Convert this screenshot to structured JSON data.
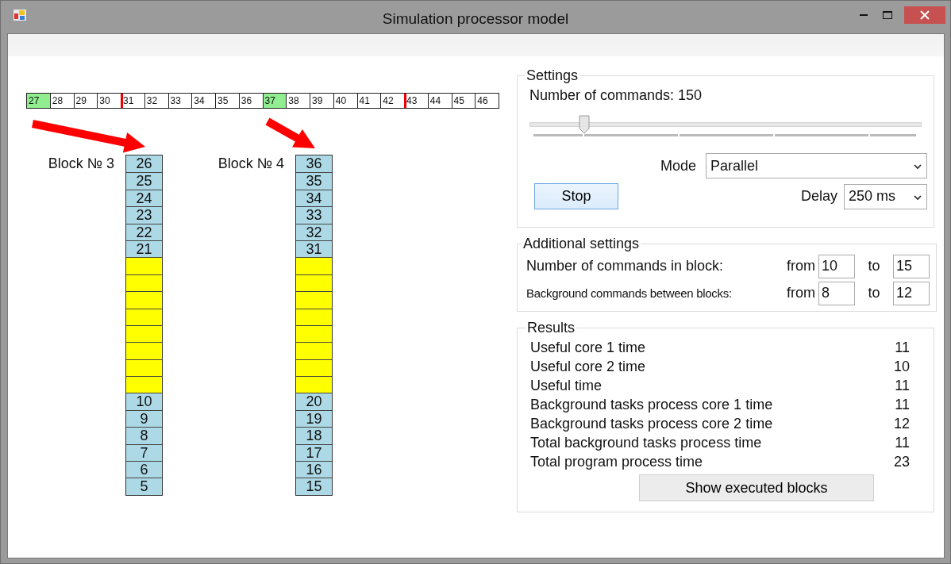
{
  "window": {
    "title": "Simulation processor model"
  },
  "command_strip": [
    {
      "text": "27",
      "highlighted": true,
      "boundary": false
    },
    {
      "text": "28",
      "highlighted": false,
      "boundary": false
    },
    {
      "text": "29",
      "highlighted": false,
      "boundary": false
    },
    {
      "text": "30",
      "highlighted": false,
      "boundary": false
    },
    {
      "text": "31",
      "highlighted": false,
      "boundary": true
    },
    {
      "text": "32",
      "highlighted": false,
      "boundary": false
    },
    {
      "text": "33",
      "highlighted": false,
      "boundary": false
    },
    {
      "text": "34",
      "highlighted": false,
      "boundary": false
    },
    {
      "text": "35",
      "highlighted": false,
      "boundary": false
    },
    {
      "text": "36",
      "highlighted": false,
      "boundary": false
    },
    {
      "text": "37",
      "highlighted": true,
      "boundary": false
    },
    {
      "text": "38",
      "highlighted": false,
      "boundary": false
    },
    {
      "text": "39",
      "highlighted": false,
      "boundary": false
    },
    {
      "text": "40",
      "highlighted": false,
      "boundary": false
    },
    {
      "text": "41",
      "highlighted": false,
      "boundary": false
    },
    {
      "text": "42",
      "highlighted": false,
      "boundary": false
    },
    {
      "text": "43",
      "highlighted": false,
      "boundary": true
    },
    {
      "text": "44",
      "highlighted": false,
      "boundary": false
    },
    {
      "text": "45",
      "highlighted": false,
      "boundary": false
    },
    {
      "text": "46",
      "highlighted": false,
      "boundary": false
    }
  ],
  "blocks": [
    {
      "label": "Block № 3",
      "cells": [
        {
          "kind": "command",
          "text": "26"
        },
        {
          "kind": "command",
          "text": "25"
        },
        {
          "kind": "command",
          "text": "24"
        },
        {
          "kind": "command",
          "text": "23"
        },
        {
          "kind": "command",
          "text": "22"
        },
        {
          "kind": "command",
          "text": "21"
        },
        {
          "kind": "background"
        },
        {
          "kind": "background"
        },
        {
          "kind": "background"
        },
        {
          "kind": "background"
        },
        {
          "kind": "background"
        },
        {
          "kind": "background"
        },
        {
          "kind": "background"
        },
        {
          "kind": "background"
        },
        {
          "kind": "command",
          "text": "10"
        },
        {
          "kind": "command",
          "text": "9"
        },
        {
          "kind": "command",
          "text": "8"
        },
        {
          "kind": "command",
          "text": "7"
        },
        {
          "kind": "command",
          "text": "6"
        },
        {
          "kind": "command",
          "text": "5"
        }
      ]
    },
    {
      "label": "Block № 4",
      "cells": [
        {
          "kind": "command",
          "text": "36"
        },
        {
          "kind": "command",
          "text": "35"
        },
        {
          "kind": "command",
          "text": "34"
        },
        {
          "kind": "command",
          "text": "33"
        },
        {
          "kind": "command",
          "text": "32"
        },
        {
          "kind": "command",
          "text": "31"
        },
        {
          "kind": "background"
        },
        {
          "kind": "background"
        },
        {
          "kind": "background"
        },
        {
          "kind": "background"
        },
        {
          "kind": "background"
        },
        {
          "kind": "background"
        },
        {
          "kind": "background"
        },
        {
          "kind": "background"
        },
        {
          "kind": "command",
          "text": "20"
        },
        {
          "kind": "command",
          "text": "19"
        },
        {
          "kind": "command",
          "text": "18"
        },
        {
          "kind": "command",
          "text": "17"
        },
        {
          "kind": "command",
          "text": "16"
        },
        {
          "kind": "command",
          "text": "15"
        }
      ]
    }
  ],
  "settings": {
    "title": "Settings",
    "commands_label": "Number of commands: 150",
    "slider": {
      "level": 0.13
    },
    "mode": {
      "label": "Mode",
      "value": "Parallel"
    },
    "stop_button": "Stop",
    "delay": {
      "label": "Delay",
      "value": "250 ms"
    }
  },
  "additional_settings": {
    "title": "Additional settings",
    "rows": [
      {
        "label": "Number of commands in block:",
        "from_label": "from",
        "from": "10",
        "to_label": "to",
        "to": "15"
      },
      {
        "label": "Background commands between blocks:",
        "from_label": "from",
        "from": "8",
        "to_label": "to",
        "to": "12"
      }
    ]
  },
  "results": {
    "title": "Results",
    "rows": [
      {
        "label": "Useful core 1 time",
        "value": "11"
      },
      {
        "label": "Useful core 2 time",
        "value": "10"
      },
      {
        "label": "Useful time",
        "value": "11"
      },
      {
        "label": "Background tasks process core 1 time",
        "value": "11"
      },
      {
        "label": "Background tasks process core 2 time",
        "value": "12"
      },
      {
        "label": "Total background tasks process time",
        "value": "11"
      },
      {
        "label": "Total program process time",
        "value": "23"
      }
    ],
    "button": "Show executed blocks"
  }
}
